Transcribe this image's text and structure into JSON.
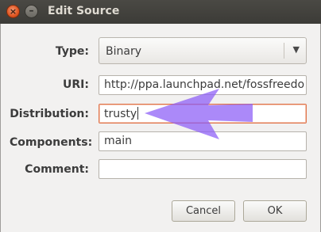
{
  "window": {
    "title": "Edit Source"
  },
  "titlebar_buttons": {
    "close_glyph": "×",
    "minimize_glyph": "–"
  },
  "form": {
    "type_label": "Type:",
    "type_value": "Binary",
    "dropdown_arrow": "▼",
    "uri_label": "URI:",
    "uri_value": "http://ppa.launchpad.net/fossfreedo",
    "distribution_label": "Distribution:",
    "distribution_value": "trusty",
    "components_label": "Components:",
    "components_value": "main",
    "comment_label": "Comment:",
    "comment_value": ""
  },
  "buttons": {
    "cancel": "Cancel",
    "ok": "OK"
  },
  "colors": {
    "annotation_arrow": "#8b5cf6",
    "focus_border": "#e0744c",
    "titlebar": "#3c3b37"
  }
}
